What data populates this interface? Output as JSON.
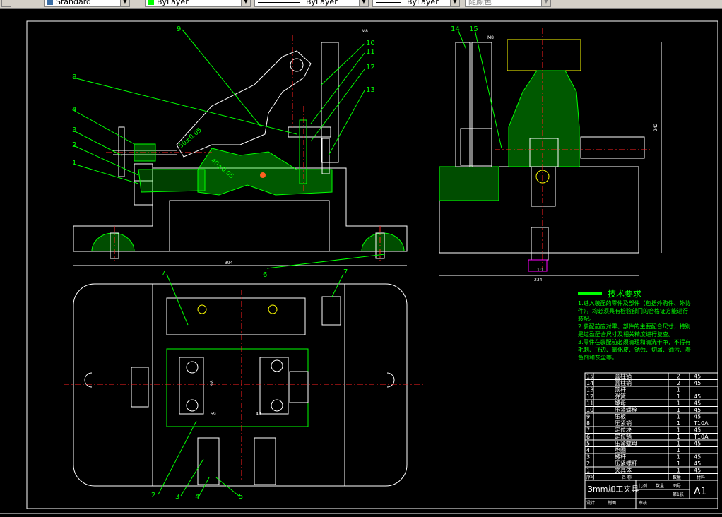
{
  "toolbar": {
    "text_style": "Standard",
    "color": "ByLayer",
    "color_hex": "#00ff00",
    "linetype": "ByLayer",
    "lineweight": "ByLayer",
    "plot_style": "随颜色"
  },
  "drawing": {
    "part_labels_front": [
      "9",
      "8",
      "4",
      "3",
      "2",
      "1",
      "10",
      "11",
      "12",
      "13"
    ],
    "part_labels_side": [
      "14",
      "15"
    ],
    "part_labels_top": [
      "7",
      "7",
      "2",
      "3",
      "4",
      "5"
    ],
    "label_6": "6",
    "dim_394": "394",
    "dim_234": "234",
    "dim_242": "242",
    "dim_98": "98",
    "dim_49": "49",
    "dim_59": "59",
    "angle_1": "50±0.05",
    "angle_2": "40±0.05",
    "small_1": "M8",
    "small_2": "M8",
    "small_3": "1:1"
  },
  "tech": {
    "title": "技术要求",
    "lines": [
      "1.进入装配的零件及部件（包括外购件、外协",
      "件），均必须具有检验部门的合格证方能进行",
      "装配。",
      "2.装配前应对零、部件的主要配合尺寸，特别",
      "是过盈配合尺寸及相关精度进行复查。",
      "3.零件在装配前必须清理和清洗干净，不得有",
      "毛刺、飞边、氧化皮、锈蚀、切屑、油污、着",
      "色剂和灰尘等。"
    ]
  },
  "bom": {
    "rows": [
      {
        "no": "15",
        "name": "圆柱销",
        "qty": "2",
        "mat": "45"
      },
      {
        "no": "14",
        "name": "圆柱销",
        "qty": "2",
        "mat": "45"
      },
      {
        "no": "13",
        "name": "顶杆",
        "qty": "1",
        "mat": ""
      },
      {
        "no": "12",
        "name": "弹簧",
        "qty": "1",
        "mat": "45"
      },
      {
        "no": "11",
        "name": "螺母",
        "qty": "1",
        "mat": "45"
      },
      {
        "no": "10",
        "name": "压紧螺栓",
        "qty": "1",
        "mat": "45"
      },
      {
        "no": "9",
        "name": "压板",
        "qty": "1",
        "mat": "45"
      },
      {
        "no": "8",
        "name": "压紧销",
        "qty": "1",
        "mat": "T10A"
      },
      {
        "no": "7",
        "name": "定位块",
        "qty": "1",
        "mat": "45"
      },
      {
        "no": "6",
        "name": "定位销",
        "qty": "1",
        "mat": "T10A"
      },
      {
        "no": "5",
        "name": "压紧螺母",
        "qty": "1",
        "mat": "45"
      },
      {
        "no": "4",
        "name": "垫圈",
        "qty": "1",
        "mat": ""
      },
      {
        "no": "3",
        "name": "螺杆",
        "qty": "1",
        "mat": "45"
      },
      {
        "no": "2",
        "name": "压紧螺杆",
        "qty": "1",
        "mat": "45"
      },
      {
        "no": "1",
        "name": "夹具体",
        "qty": "1",
        "mat": "45"
      }
    ],
    "header": {
      "no": "序号",
      "name": "名 称",
      "qty": "数量",
      "mat": "材料"
    },
    "title": "3mm加工夹具",
    "scale_label": "比例",
    "qty_label": "数量",
    "sheet": "图号",
    "sheet_count": "第1张",
    "size": "A1",
    "designer": "设计",
    "drawer": "制图",
    "checker": "审核"
  }
}
